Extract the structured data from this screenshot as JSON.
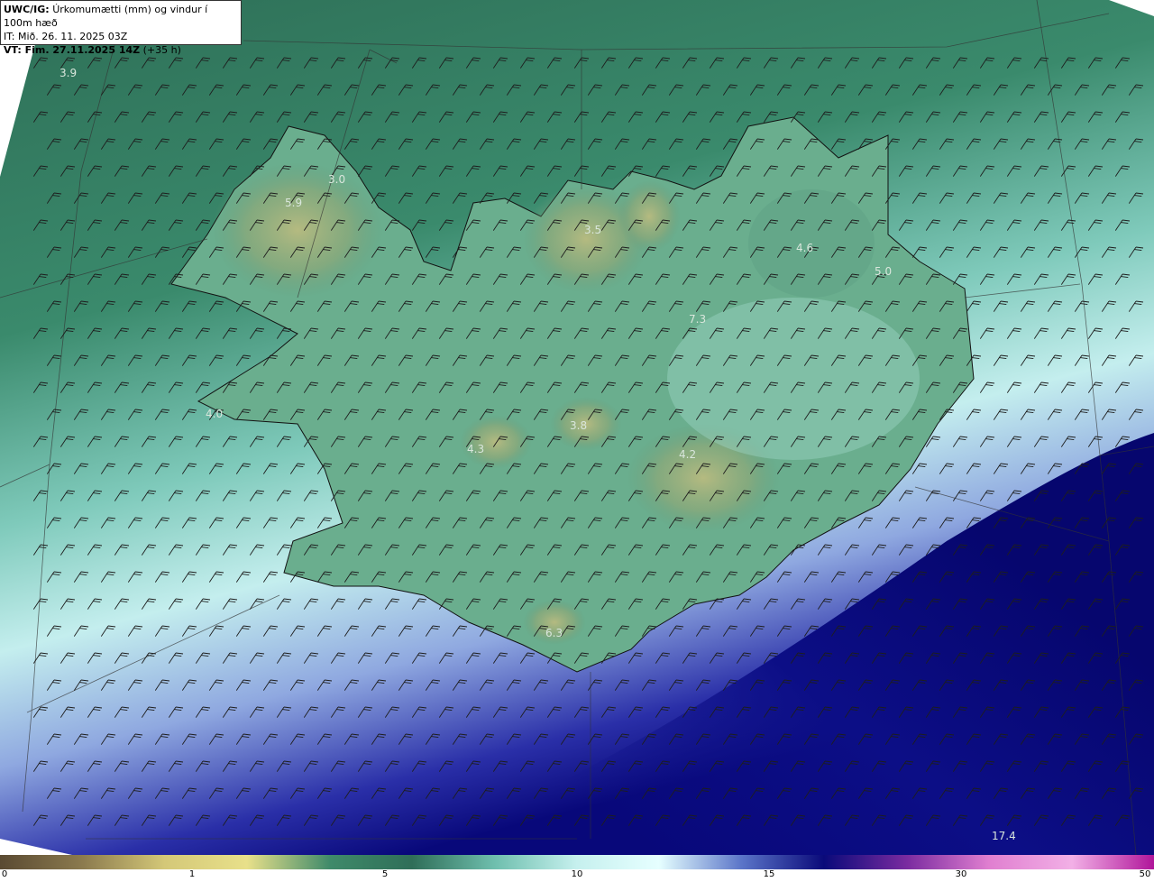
{
  "header": {
    "model": "UWC/IG:",
    "title": "Úrkomumætti (mm) og vindur í 100m hæð",
    "init_time": "IT: Mið. 26. 11. 2025 03Z",
    "valid_label": "VT: Fim. 27.11.2025 14Z",
    "lead": "(+35 h)"
  },
  "map_labels": [
    "3.9",
    "3.0",
    "5.9",
    "3.5",
    "4.6",
    "5.0",
    "7.3",
    "4.0",
    "3.8",
    "4.3",
    "4.2",
    "6.3",
    "17.4"
  ],
  "colorbar": {
    "ticks": [
      "0",
      "1",
      "5",
      "10",
      "15",
      "30",
      "50"
    ],
    "colors": [
      "#5a4a32",
      "#8b7a4e",
      "#d4c878",
      "#e8e08a",
      "#3f8a6a",
      "#2f6e58",
      "#6fbfae",
      "#c6f0ee",
      "#e6ffff",
      "#5a74c8",
      "#0a0a7a",
      "#7a2ba0",
      "#e07fd0",
      "#f2b0e6",
      "#b0159a"
    ]
  },
  "palette": {
    "sea_north": "#2f6e58",
    "land_high": "#a4b07c",
    "sea_south": "#c6eef0",
    "deep_blue": "#08087a",
    "coastline": "#111111",
    "barb": "#222222"
  }
}
